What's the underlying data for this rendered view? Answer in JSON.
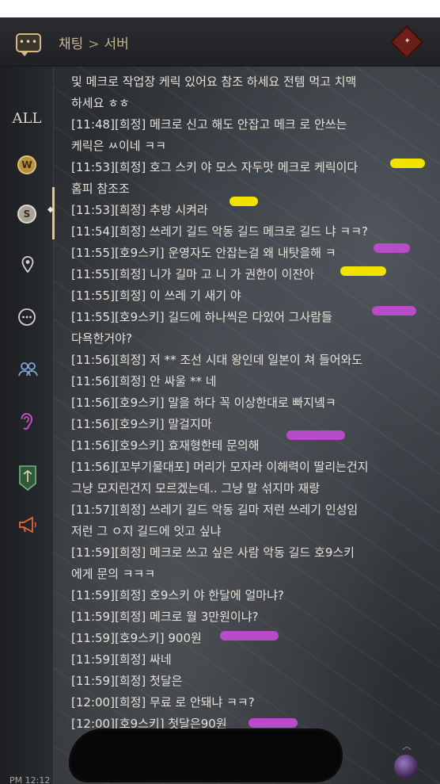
{
  "header": {
    "channel": "채팅",
    "sub_channel": "서버"
  },
  "sidebar": {
    "all_label": "ALL",
    "items": [
      {
        "icon": "all-tab-icon"
      },
      {
        "icon": "guild-w-coin-icon"
      },
      {
        "icon": "server-s-coin-icon",
        "active": true
      },
      {
        "icon": "location-pin-icon"
      },
      {
        "icon": "speech-bubble-icon"
      },
      {
        "icon": "party-people-icon"
      },
      {
        "icon": "whisper-ear-icon"
      },
      {
        "icon": "guild-banner-icon"
      },
      {
        "icon": "megaphone-icon"
      }
    ]
  },
  "chat": {
    "lines": [
      {
        "text": "및 메크로 작업장 케릭 있어요 참조 하세요 전템 먹고 치맥"
      },
      {
        "text": "하세요 ㅎㅎ"
      },
      {
        "time": "[11:48]",
        "name": "[희정]",
        "text": " 메크로 신고 해도 안잡고 메크 로 안쓰는"
      },
      {
        "text": "케릭은 ㅆ이네 ㅋㅋ"
      },
      {
        "time": "[11:53]",
        "name": "[희정]",
        "text": " 호그 스키 야 모스 자두맛 메크로 케릭이다"
      },
      {
        "text": "홈피 참조조"
      },
      {
        "time": "[11:53]",
        "name": "[희정]",
        "text": " 추방 시켜라"
      },
      {
        "time": "[11:54]",
        "name": "[희정]",
        "text": " 쓰레기 길드 악동 길드 메크로 길드 냐 ㅋㅋ?"
      },
      {
        "time": "[11:55]",
        "name": "[호9스키]",
        "text": " 운영자도 안잡는걸 왜 내탓을해 ㅋ"
      },
      {
        "time": "[11:55]",
        "name": "[희정]",
        "text": " 니가 길마 고  니 가 권한이 이잔아"
      },
      {
        "time": "[11:55]",
        "name": "[희정]",
        "text": " 이 쓰레 기 새기 야"
      },
      {
        "time": "[11:55]",
        "name": "[호9스키]",
        "text": " 길드에 하나씩은 다있어 그사람들"
      },
      {
        "text": "다욕한거야?"
      },
      {
        "time": "[11:56]",
        "name": "[희정]",
        "text": " 저 ** 조선 시대 왕인데 일본이 쳐 들어와도"
      },
      {
        "time": "[11:56]",
        "name": "[희정]",
        "text": " 안 싸울 ** 네"
      },
      {
        "time": "[11:56]",
        "name": "[호9스키]",
        "text": " 말을 하다 꼭 이상한대로 빠지녴ㅋ"
      },
      {
        "time": "[11:56]",
        "name": "[호9스키]",
        "text": " 말걸지마"
      },
      {
        "time": "[11:56]",
        "name": "[호9스키]",
        "text": " 효재형한테 문의해"
      },
      {
        "time": "[11:56]",
        "name": "[꼬부기물대포]",
        "text": " 머리가 모자라 이해력이 딸리는건지"
      },
      {
        "text": "그냥 모지린건지 모르겠는데.. 그냥 말 섞지마 재랑"
      },
      {
        "time": "[11:57]",
        "name": "[희정]",
        "text": " 쓰레기 길드  악동 길마 저런 쓰레기 인성임"
      },
      {
        "text": "저런 그 ㅇ지 길드에  잇고 싶냐"
      },
      {
        "time": "[11:59]",
        "name": "[희정]",
        "text": " 메크로 쓰고 싶은 사람 악동 길드 호9스키"
      },
      {
        "text": "에게 문의 ㅋㅋㅋ"
      },
      {
        "time": "[11:59]",
        "name": "[희정]",
        "text": " 호9스키 야 한달에 얼마냐?"
      },
      {
        "time": "[11:59]",
        "name": "[희정]",
        "text": " 메크로 월 3만원이냐?"
      },
      {
        "time": "[11:59]",
        "name": "[호9스키]",
        "text": " 900원"
      },
      {
        "time": "[11:59]",
        "name": "[희정]",
        "text": " 싸네"
      },
      {
        "time": "[11:59]",
        "name": "[희정]",
        "text": " 첫달은"
      },
      {
        "time": "[12:00]",
        "name": "[희정]",
        "text": " 무료 로 안돼냐 ㅋㅋ?"
      },
      {
        "time": "[12:00]",
        "name": "[호9스키]",
        "text": " 첫달은90원"
      }
    ]
  },
  "footer": {
    "clock": "PM 12:12"
  },
  "colors": {
    "highlight_yellow": "#f2e200",
    "highlight_purple": "#b74bc8",
    "header_text": "#c9b493"
  }
}
